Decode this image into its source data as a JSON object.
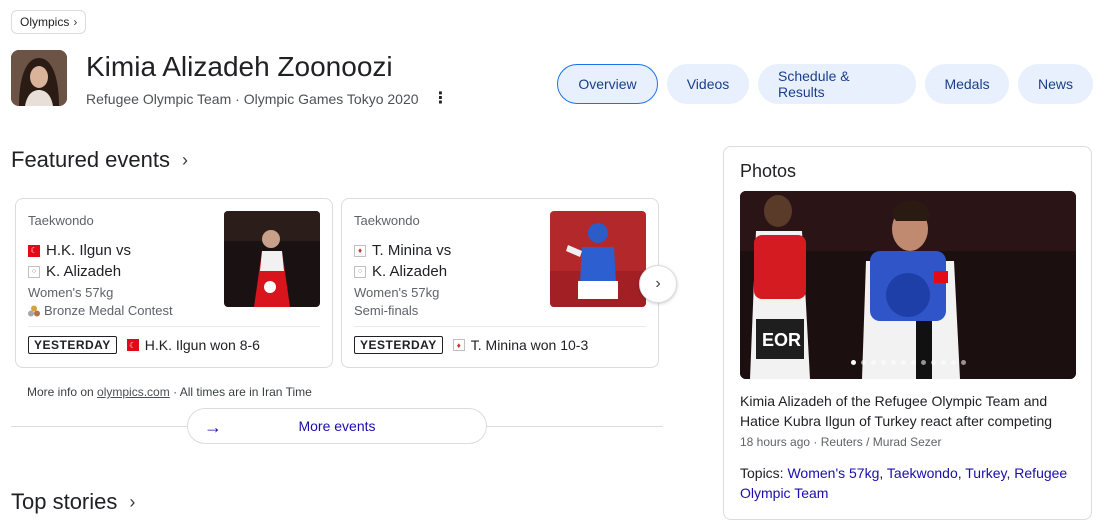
{
  "breadcrumb": {
    "label": "Olympics",
    "chevron": "›"
  },
  "athlete": {
    "name": "Kimia Alizadeh Zoonoozi",
    "team": "Refugee Olympic Team",
    "separator": "·",
    "games": "Olympic Games Tokyo 2020"
  },
  "tabs": [
    {
      "label": "Overview",
      "active": true
    },
    {
      "label": "Videos"
    },
    {
      "label": "Schedule & Results"
    },
    {
      "label": "Medals"
    },
    {
      "label": "News"
    }
  ],
  "featured": {
    "title": "Featured events",
    "cards": [
      {
        "sport": "Taekwondo",
        "player1": "H.K. Ilgun vs",
        "player2": "K. Alizadeh",
        "category": "Women's 57kg",
        "round": "Bronze Medal Contest",
        "date_badge": "YESTERDAY",
        "result": "H.K. Ilgun won 8-6"
      },
      {
        "sport": "Taekwondo",
        "player1": "T. Minina vs",
        "player2": "K. Alizadeh",
        "category": "Women's 57kg",
        "round": "Semi-finals",
        "date_badge": "YESTERDAY",
        "result": "T. Minina won 10-3"
      }
    ],
    "more_info_prefix": "More info on",
    "more_info_link": "olympics.com",
    "more_info_suffix": "· All times are in Iran Time",
    "more_events_label": "More events"
  },
  "top_stories": {
    "title": "Top stories"
  },
  "photos": {
    "title": "Photos",
    "caption": "Kimia Alizadeh of the Refugee Olympic Team and Hatice Kubra Ilgun of Turkey react after competing",
    "time": "18 hours ago",
    "credit": "Reuters / Murad Sezer",
    "topics_label": "Topics:",
    "topics": [
      "Women's 57kg",
      "Taekwondo",
      "Turkey",
      "Refugee Olympic Team"
    ],
    "image_text": "EOR"
  },
  "colors": {
    "tab_bg": "#e8f0fe",
    "tab_text": "#1a3f8a",
    "link": "#1a0dab",
    "turkey_red": "#e30a17"
  }
}
